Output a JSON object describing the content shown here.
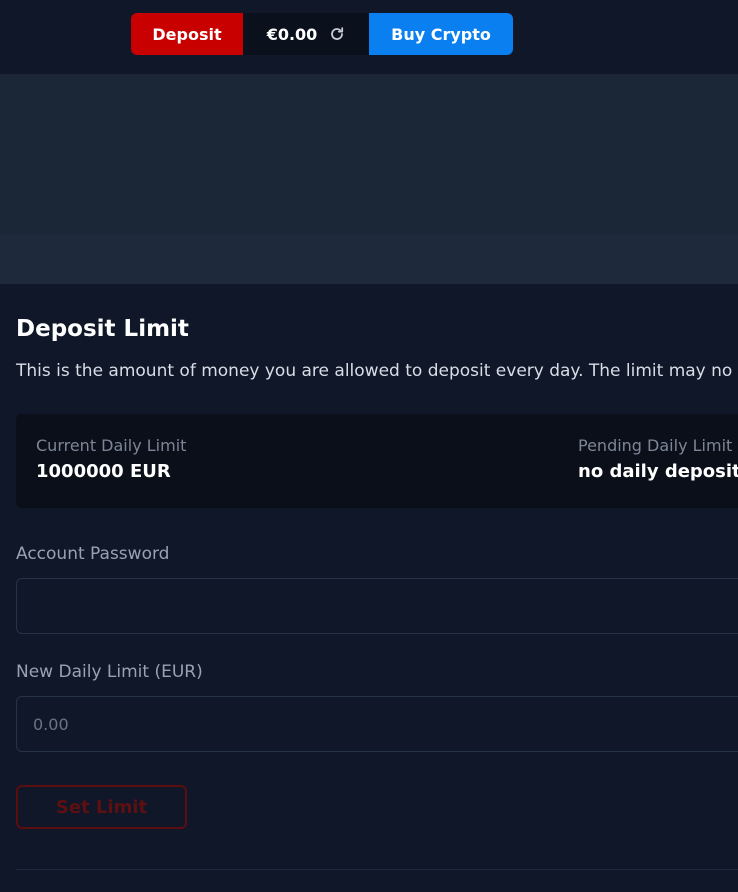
{
  "header": {
    "deposit_label": "Deposit",
    "balance": "€0.00",
    "buy_crypto_label": "Buy Crypto"
  },
  "deposit_limit": {
    "title": "Deposit Limit",
    "description": "This is the amount of money you are allowed to deposit every day. The limit may no",
    "current": {
      "label": "Current Daily Limit",
      "value": "1000000 EUR"
    },
    "pending": {
      "label": "Pending Daily Limit",
      "value": "no daily deposit"
    },
    "password_field": {
      "label": "Account Password",
      "value": "",
      "placeholder": ""
    },
    "new_limit_field": {
      "label": "New Daily Limit (EUR)",
      "value": "",
      "placeholder": "0.00"
    },
    "submit_label": "Set Limit"
  },
  "colors": {
    "background": "#0f1728",
    "deposit_red": "#c80000",
    "buy_blue": "#0a7ff0",
    "card_bg": "#0a0f1a",
    "disabled_button": "#5e0f12"
  }
}
